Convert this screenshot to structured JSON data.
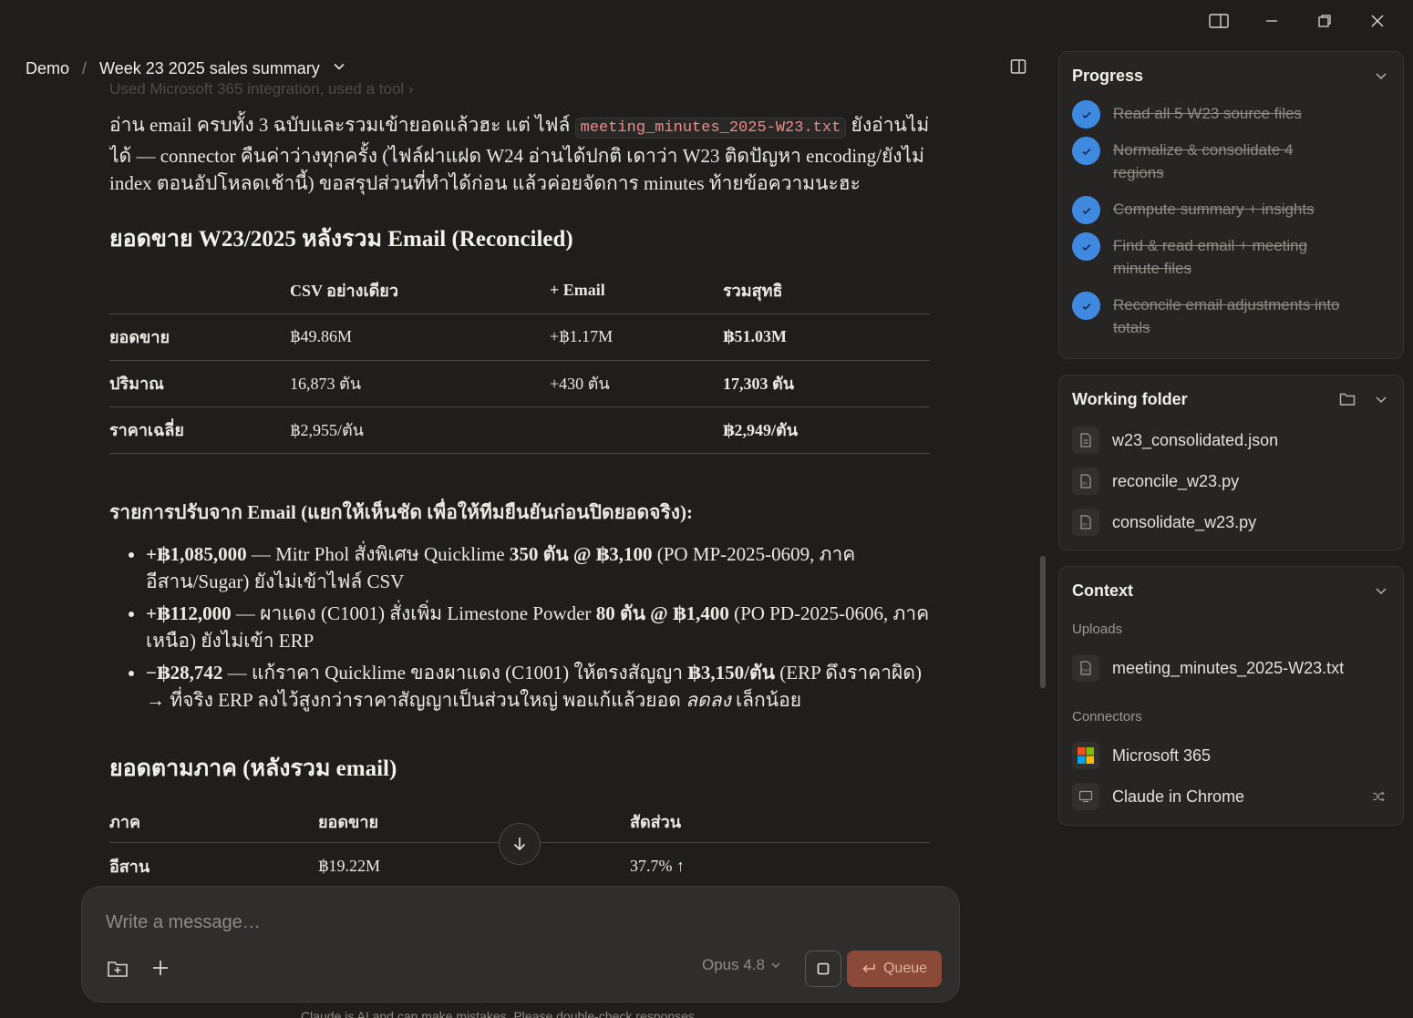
{
  "breadcrumb": {
    "root": "Demo",
    "separator": "/",
    "title": "Week 23 2025 sales summary"
  },
  "main": {
    "faded_tool_line": "Used Microsoft 365 integration, used a tool ›",
    "intro": {
      "part1": "อ่าน email ครบทั้ง 3 ฉบับและรวมเข้ายอดแล้วฮะ แต่ ไฟล์ ",
      "code": "meeting_minutes_2025-W23.txt",
      "part2": " ยังอ่านไม่ได้ — connector คืนค่าว่างทุกครั้ง (ไฟล์ฝาแฝด W24 อ่านได้ปกติ เดาว่า W23 ติดปัญหา encoding/ยังไม่ index ตอนอัปโหลดเช้านี้) ขอสรุปส่วนที่ทำได้ก่อน แล้วค่อยจัดการ minutes ท้ายข้อความนะฮะ"
    },
    "reconciled": {
      "heading": "ยอดขาย W23/2025 หลังรวม Email (Reconciled)",
      "headers": [
        "",
        "CSV อย่างเดียว",
        "+ Email",
        "รวมสุทธิ"
      ],
      "rows": [
        [
          "ยอดขาย",
          "฿49.86M",
          "+฿1.17M",
          "฿51.03M"
        ],
        [
          "ปริมาณ",
          "16,873 ตัน",
          "+430 ตัน",
          "17,303 ตัน"
        ],
        [
          "ราคาเฉลี่ย",
          "฿2,955/ตัน",
          "",
          "฿2,949/ตัน"
        ]
      ]
    },
    "adjust_heading": "รายการปรับจาก Email (แยกให้เห็นชัด เพื่อให้ทีมยืนยันก่อนปิดยอดจริง):",
    "adjustments": [
      {
        "amount": "+฿1,085,000",
        "text1": " — Mitr Phol สั่งพิเศษ Quicklime ",
        "qty": "350 ตัน @ ฿3,100",
        "text2": " (PO MP-2025-0609, ภาคอีสาน/Sugar) ยังไม่เข้าไฟล์ CSV"
      },
      {
        "amount": "+฿112,000",
        "text1": " — ผาแดง (C1001) สั่งเพิ่ม Limestone Powder ",
        "qty": "80 ตัน @ ฿1,400",
        "text2": " (PO PD-2025-0606, ภาคเหนือ) ยังไม่เข้า ERP"
      },
      {
        "amount": "−฿28,742",
        "text1": " — แก้ราคา Quicklime ของผาแดง (C1001) ให้ตรงสัญญา ",
        "qty": "฿3,150/ตัน",
        "text2": " (ERP ดึงราคาผิด) → ที่จริง ERP ลงไว้สูงกว่าราคาสัญญาเป็นส่วนใหญ่ พอแก้แล้วยอด ",
        "em": "ลดลง",
        "text3": " เล็กน้อย"
      }
    ],
    "regional": {
      "heading": "ยอดตามภาค (หลังรวม email)",
      "headers": [
        "ภาค",
        "ยอดขาย",
        "สัดส่วน"
      ],
      "rows": [
        [
          "อีสาน",
          "฿19.22M",
          "37.7% ↑"
        ]
      ]
    }
  },
  "composer": {
    "placeholder": "Write a message…",
    "model": "Opus 4.8",
    "queue_label": "Queue",
    "disclaimer": "Claude is AI and can make mistakes. Please double-check responses."
  },
  "progress": {
    "title": "Progress",
    "items": [
      "Read all 5 W23 source files",
      "Normalize & consolidate 4 regions",
      "Compute summary + insights",
      "Find & read email + meeting minute files",
      "Reconcile email adjustments into totals"
    ]
  },
  "working_folder": {
    "title": "Working folder",
    "files": [
      "w23_consolidated.json",
      "reconcile_w23.py",
      "consolidate_w23.py"
    ]
  },
  "context": {
    "title": "Context",
    "uploads_label": "Uploads",
    "uploads": [
      "meeting_minutes_2025-W23.txt"
    ],
    "connectors_label": "Connectors",
    "connectors": [
      "Microsoft 365",
      "Claude in Chrome"
    ]
  },
  "colors": {
    "accent_blue": "#3f8ae0",
    "queue_button": "#8a4a37",
    "background": "#1f1e1d"
  }
}
